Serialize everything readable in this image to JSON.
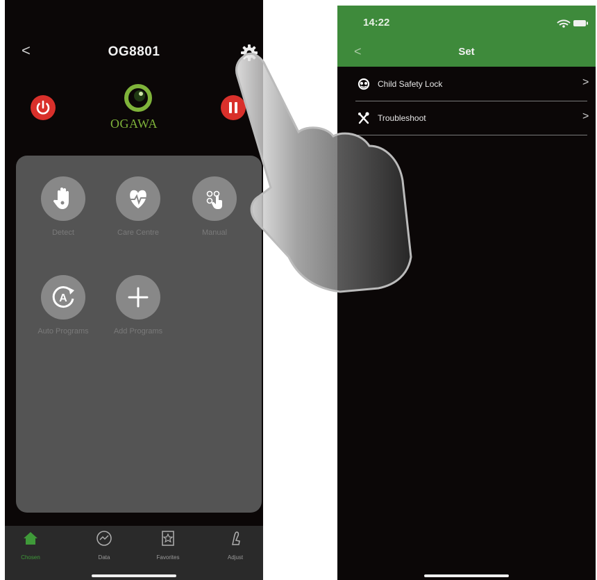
{
  "left_screen": {
    "header": {
      "back_icon": "chevron-left",
      "title": "OG8801",
      "settings_icon": "gear-icon"
    },
    "controls": {
      "power_icon": "power-icon",
      "pause_icon": "pause-icon",
      "power_color": "#d9302b"
    },
    "logo": {
      "text": "OGAWA",
      "color": "#7fb33a"
    },
    "programs": [
      {
        "icon": "hand-icon",
        "label": "Detect"
      },
      {
        "icon": "heart-pulse-icon",
        "label": "Care Centre"
      },
      {
        "icon": "manual-icon",
        "label": "Manual"
      },
      {
        "icon": "auto-icon",
        "label": "Auto Programs"
      },
      {
        "icon": "plus-icon",
        "label": "Add Programs"
      }
    ],
    "tabbar": [
      {
        "icon": "home-icon",
        "label": "Chosen",
        "active": true
      },
      {
        "icon": "data-icon",
        "label": "Data",
        "active": false
      },
      {
        "icon": "favorites-icon",
        "label": "Favorites",
        "active": false
      },
      {
        "icon": "adjust-icon",
        "label": "Adjust",
        "active": false
      }
    ]
  },
  "right_screen": {
    "status_bar": {
      "time": "14:22"
    },
    "header": {
      "back_icon": "chevron-left",
      "title": "Set",
      "color": "#3e8a3b"
    },
    "menu": [
      {
        "icon": "lock-icon",
        "label": "Child Safety Lock",
        "chevron": ">"
      },
      {
        "icon": "tools-icon",
        "label": "Troubleshoot",
        "chevron": ">"
      }
    ]
  },
  "glyphs": {
    "back": "<",
    "chevron": ">"
  }
}
